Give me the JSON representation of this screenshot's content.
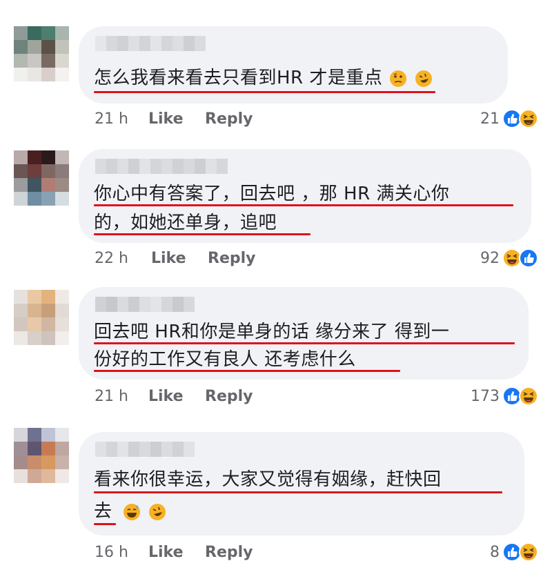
{
  "comments": [
    {
      "lines": [
        "怎么我看来看去只看到HR 才是重点"
      ],
      "inline_emojis": [
        "thinking-face-emoji",
        "rolling-on-floor-laughing-emoji"
      ],
      "time": "21 h",
      "like_label": "Like",
      "reply_label": "Reply",
      "reaction_count": "21",
      "reactions": [
        "like-reaction-icon",
        "haha-reaction-icon"
      ]
    },
    {
      "lines": [
        "你心中有答案了，回去吧 ，那 HR  满关心你",
        "的，如她还单身，追吧"
      ],
      "time": "22 h",
      "like_label": "Like",
      "reply_label": "Reply",
      "reaction_count": "92",
      "reactions": [
        "haha-reaction-icon",
        "like-reaction-icon"
      ]
    },
    {
      "lines": [
        "回去吧 HR和你是单身的话 缘分来了 得到一",
        "份好的工作又有良人 还考虑什么"
      ],
      "time": "21 h",
      "like_label": "Like",
      "reply_label": "Reply",
      "reaction_count": "173",
      "reactions": [
        "like-reaction-icon",
        "haha-reaction-icon"
      ]
    },
    {
      "lines": [
        "看来你很幸运，大家又觉得有姻缘，赶快回",
        "去"
      ],
      "inline_emojis": [
        "sweat-smile-emoji",
        "rolling-on-floor-laughing-emoji"
      ],
      "time": "16 h",
      "like_label": "Like",
      "reply_label": "Reply",
      "reaction_count": "8",
      "reactions": [
        "like-reaction-icon",
        "haha-reaction-icon"
      ]
    }
  ],
  "colors": {
    "bubble": "#f0f2f5",
    "text": "#1c1e21",
    "meta": "#65676b",
    "underline": "#e0101a",
    "like_blue": "#1877f2",
    "haha_yellow": "#f7b125"
  }
}
